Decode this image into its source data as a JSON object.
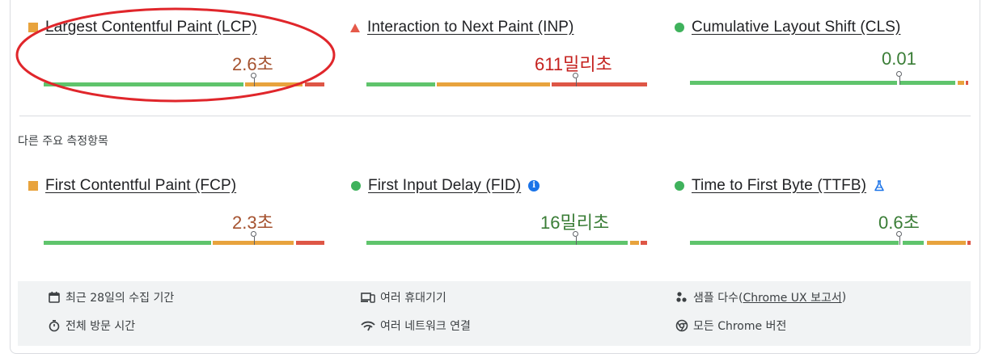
{
  "core_metrics": [
    {
      "label": "Largest Contentful Paint (LCP)",
      "value": "2.6초",
      "status": "needs-improvement",
      "status_icon": "orange-square-icon"
    },
    {
      "label": "Interaction to Next Paint (INP)",
      "value": "611밀리초",
      "status": "poor",
      "status_icon": "red-triangle-icon"
    },
    {
      "label": "Cumulative Layout Shift (CLS)",
      "value": "0.01",
      "status": "good",
      "status_icon": "green-circle-icon"
    }
  ],
  "other_section_title": "다른 주요 측정항목",
  "other_metrics": [
    {
      "label": "First Contentful Paint (FCP)",
      "value": "2.3초",
      "status": "needs-improvement",
      "status_icon": "orange-square-icon"
    },
    {
      "label": "First Input Delay (FID)",
      "value": "16밀리초",
      "status": "good",
      "status_icon": "green-circle-icon",
      "extra_icon": "info-icon"
    },
    {
      "label": "Time to First Byte (TTFB)",
      "value": "0.6초",
      "status": "good",
      "status_icon": "green-circle-icon",
      "extra_icon": "flask-icon"
    }
  ],
  "footer": {
    "period": "최근 28일의 수집 기간",
    "devices": "여러 휴대기기",
    "samples_prefix": "샘플 다수(",
    "samples_link": "Chrome UX 보고서",
    "samples_suffix": ")",
    "visit": "전체 방문 시간",
    "network": "여러 네트워크 연결",
    "chrome": "모든 Chrome 버전"
  },
  "colors": {
    "good": "#5fc46c",
    "needs_improvement": "#e8a33d",
    "poor": "#de5646",
    "highlight_circle": "#e0262b"
  }
}
